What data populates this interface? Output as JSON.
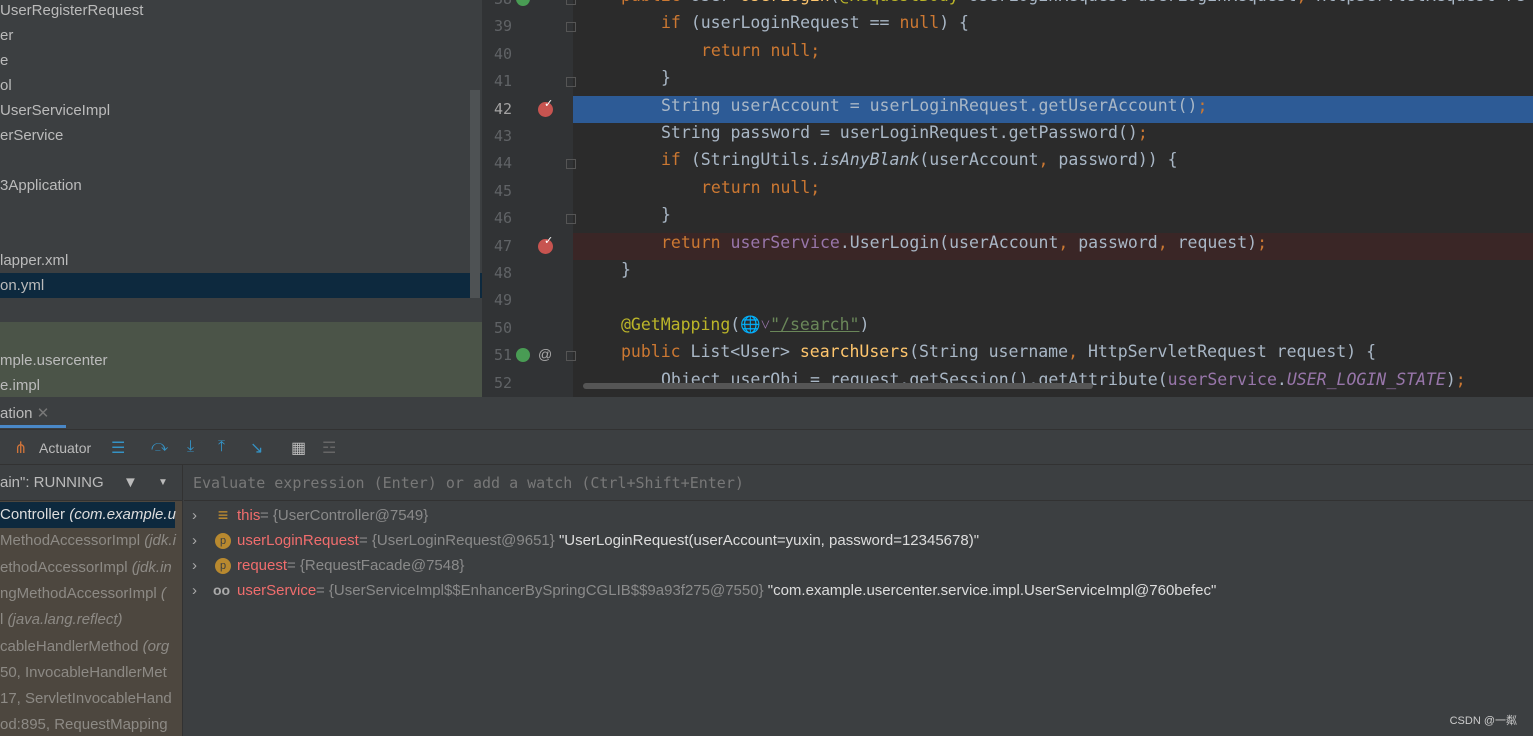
{
  "project_tree": {
    "items": [
      "UserRegisterRequest",
      "er",
      "e",
      "ol",
      "UserServiceImpl",
      "erService",
      "",
      "3Application",
      "",
      "",
      "lapper.xml",
      "on.yml",
      "",
      "",
      "mple.usercenter",
      "e.impl"
    ],
    "selected_index": 11
  },
  "editor": {
    "lines": [
      {
        "n": "38",
        "tokens": [
          [
            "public ",
            "kw"
          ],
          [
            "User ",
            ""
          ],
          [
            "UserLogin",
            "fn"
          ],
          [
            "(",
            ""
          ],
          [
            "@RequestBody ",
            "an"
          ],
          [
            "UserLoginRequest userLoginRequest",
            ""
          ],
          [
            ", ",
            "kw"
          ],
          [
            "HttpServletRequest re",
            ""
          ]
        ],
        "indent": 1
      },
      {
        "n": "39",
        "tokens": [
          [
            "if ",
            "kw"
          ],
          [
            "(userLoginRequest == ",
            ""
          ],
          [
            "null",
            "kw"
          ],
          [
            ") {",
            ""
          ]
        ],
        "indent": 2
      },
      {
        "n": "40",
        "tokens": [
          [
            "return null;",
            "kw"
          ]
        ],
        "indent": 3
      },
      {
        "n": "41",
        "tokens": [
          [
            "}",
            ""
          ]
        ],
        "indent": 2
      },
      {
        "n": "42",
        "tokens": [
          [
            "String userAccount = userLoginRequest.getUserAccount()",
            ""
          ],
          [
            ";",
            "kw"
          ]
        ],
        "indent": 2,
        "state": "current",
        "breakpoint": true
      },
      {
        "n": "43",
        "tokens": [
          [
            "String password = userLoginRequest.getPassword()",
            ""
          ],
          [
            ";",
            "kw"
          ]
        ],
        "indent": 2
      },
      {
        "n": "44",
        "tokens": [
          [
            "if ",
            "kw"
          ],
          [
            "(StringUtils.",
            ""
          ],
          [
            "isAnyBlank",
            "it"
          ],
          [
            "(userAccount",
            ""
          ],
          [
            ", ",
            "kw"
          ],
          [
            "password)) {",
            ""
          ]
        ],
        "indent": 2
      },
      {
        "n": "45",
        "tokens": [
          [
            "return null;",
            "kw"
          ]
        ],
        "indent": 3
      },
      {
        "n": "46",
        "tokens": [
          [
            "}",
            ""
          ]
        ],
        "indent": 2
      },
      {
        "n": "47",
        "tokens": [
          [
            "return ",
            "kw"
          ],
          [
            "userService",
            "fd"
          ],
          [
            ".UserLogin(userAccount",
            ""
          ],
          [
            ", ",
            "kw"
          ],
          [
            "password",
            ""
          ],
          [
            ", ",
            "kw"
          ],
          [
            "request)",
            ""
          ],
          [
            ";",
            "kw"
          ]
        ],
        "indent": 2,
        "state": "breakpoint",
        "breakpoint": true
      },
      {
        "n": "48",
        "tokens": [
          [
            "}",
            ""
          ]
        ],
        "indent": 1
      },
      {
        "n": "49",
        "tokens": [],
        "indent": 1
      },
      {
        "n": "50",
        "tokens": [
          [
            "@GetMapping",
            "an"
          ],
          [
            "(",
            ""
          ],
          [
            "🌐˅",
            "fd"
          ],
          [
            "\"/search\"",
            "st"
          ],
          [
            ")",
            ""
          ]
        ],
        "indent": 1
      },
      {
        "n": "51",
        "tokens": [
          [
            "public ",
            "kw"
          ],
          [
            "List<User> ",
            ""
          ],
          [
            "searchUsers",
            "fn"
          ],
          [
            "(String username",
            ""
          ],
          [
            ", ",
            "kw"
          ],
          [
            "HttpServletRequest request) {",
            ""
          ]
        ],
        "indent": 1
      },
      {
        "n": "52",
        "tokens": [
          [
            "Object userObj = request.getSession().getAttribute(",
            ""
          ],
          [
            "userService",
            "fd"
          ],
          [
            ".",
            ""
          ],
          [
            "USER_LOGIN_STATE",
            "fdi"
          ],
          [
            ")",
            ""
          ],
          [
            ";",
            "kw"
          ]
        ],
        "indent": 2
      }
    ]
  },
  "debug": {
    "tab_label": "ation",
    "toolbar": {
      "actuator_label": "Actuator"
    },
    "thread_status": "ain\": RUNNING",
    "frames": [
      {
        "name": "Controller ",
        "pkg": "(com.example.u"
      },
      {
        "name": "MethodAccessorImpl ",
        "pkg": "(jdk.i"
      },
      {
        "name": "ethodAccessorImpl ",
        "pkg": "(jdk.in"
      },
      {
        "name": "ngMethodAccessorImpl ",
        "pkg": "("
      },
      {
        "name": "l ",
        "pkg": "(java.lang.reflect)"
      },
      {
        "name": "cableHandlerMethod ",
        "pkg": "(org"
      },
      {
        "name": " 50, InvocableHandlerMet",
        "pkg": ""
      },
      {
        "name": "17, ServletInvocableHand",
        "pkg": ""
      },
      {
        "name": "od:895, RequestMapping",
        "pkg": ""
      }
    ],
    "evaluate_placeholder": "Evaluate expression (Enter) or add a watch (Ctrl+Shift+Enter)",
    "variables": [
      {
        "icon": "field-list-icon",
        "name": "this",
        "value": " = {UserController@7549}",
        "str": ""
      },
      {
        "icon": "parameter-icon",
        "name": "userLoginRequest",
        "value": " = {UserLoginRequest@9651} ",
        "str": "\"UserLoginRequest(userAccount=yuxin, password=12345678)\""
      },
      {
        "icon": "parameter-icon",
        "name": "request",
        "value": " = {RequestFacade@7548}",
        "str": ""
      },
      {
        "icon": "watch-glasses-icon",
        "name": "userService",
        "value": " = {UserServiceImpl$$EnhancerBySpringCGLIB$$9a93f275@7550} ",
        "str": "\"com.example.usercenter.service.impl.UserServiceImpl@760befec\""
      }
    ]
  },
  "watermark": "CSDN @一粼"
}
